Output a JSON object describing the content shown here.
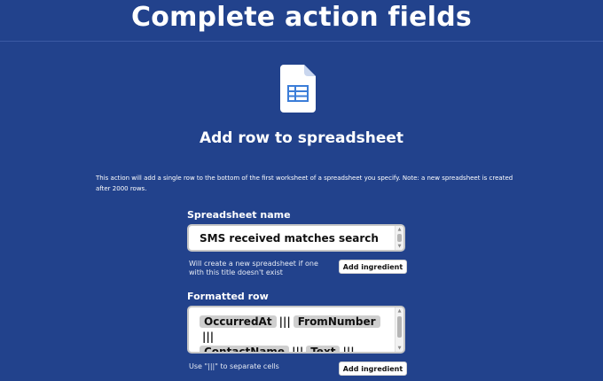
{
  "header": {
    "title": "Complete action fields"
  },
  "action": {
    "icon": "spreadsheet-icon",
    "title": "Add row to spreadsheet",
    "description": "This action will add a single row to the bottom of the first worksheet of a spreadsheet you specify. Note: a new spreadsheet is created after 2000 rows."
  },
  "spreadsheet_name": {
    "label": "Spreadsheet name",
    "value": "SMS received matches search",
    "helper": "Will create a new spreadsheet if one with this title doesn't exist",
    "button": "Add ingredient"
  },
  "formatted_row": {
    "label": "Formatted row",
    "ingredients": [
      "OccurredAt",
      "FromNumber",
      "ContactName",
      "Text"
    ],
    "separator": "|||",
    "helper": "Use \"|||\" to separate cells",
    "button": "Add ingredient"
  },
  "colors": {
    "background": "#22428c",
    "icon_blue": "#3b7dd8"
  }
}
